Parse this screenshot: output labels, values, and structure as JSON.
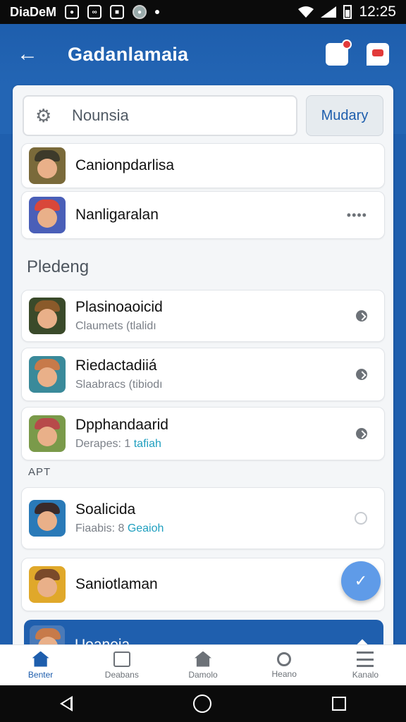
{
  "status_bar": {
    "carrier": "DiaDeM",
    "time": "12:25"
  },
  "app_bar": {
    "title": "Gadanlamaia",
    "back_icon": "arrow-left-icon",
    "actions": [
      "filter-badge-icon",
      "chat-badge-icon"
    ]
  },
  "search": {
    "value": "Nounsia",
    "icon": "gear-icon",
    "button_label": "Mudary"
  },
  "top_items": [
    {
      "name": "Canionpdarlisa",
      "avatar_colors": [
        "#7a6a3a",
        "#3d3a2a"
      ]
    },
    {
      "name": "Nanligaralan",
      "more": "••••",
      "avatar_colors": [
        "#d9473a",
        "#4a5fb8"
      ]
    }
  ],
  "section_pledeng": "Pledeng",
  "pledeng_items": [
    {
      "name": "Plasinoaoicid",
      "sub": "Claumets (tlalidı",
      "accent": "",
      "avatar_colors": [
        "#8a5a2a",
        "#3a4a2a"
      ]
    },
    {
      "name": "Riedactadiiá",
      "sub": "Slaabracs (tibiodı",
      "accent": "",
      "avatar_colors": [
        "#3a8a9a",
        "#c77a4a"
      ]
    },
    {
      "name": "Dpphandaarid",
      "sub": "Derapes: 1 ",
      "accent": "tafiah",
      "avatar_colors": [
        "#7a9a4a",
        "#b74a4a"
      ]
    }
  ],
  "section_apt": "APT",
  "apt_items": [
    {
      "name": "Soalicida",
      "sub": "Fiaabis: 8 ",
      "accent": "Geaioh",
      "avatar_colors": [
        "#2a7ab8",
        "#3a2a2a"
      ]
    },
    {
      "name": "Saniotlaman",
      "sub": "",
      "accent": "",
      "avatar_colors": [
        "#e0a82a",
        "#7a4a2a"
      ]
    }
  ],
  "featured": {
    "title": "Uoaneia",
    "avatar_colors": [
      "#4a7ab8",
      "#c77a4a"
    ]
  },
  "fab_icon": "check-icon",
  "bottom_nav": [
    {
      "label": "Benter",
      "icon": "home-icon",
      "active": true
    },
    {
      "label": "Deabans",
      "icon": "card-icon",
      "active": false
    },
    {
      "label": "Damolo",
      "icon": "home-icon",
      "active": false
    },
    {
      "label": "Heano",
      "icon": "search-icon",
      "active": false
    },
    {
      "label": "Kanalo",
      "icon": "list-icon",
      "active": false
    }
  ],
  "colors": {
    "primary": "#1e5ead",
    "accent": "#1f9fbf",
    "fab": "#5f9be8"
  }
}
